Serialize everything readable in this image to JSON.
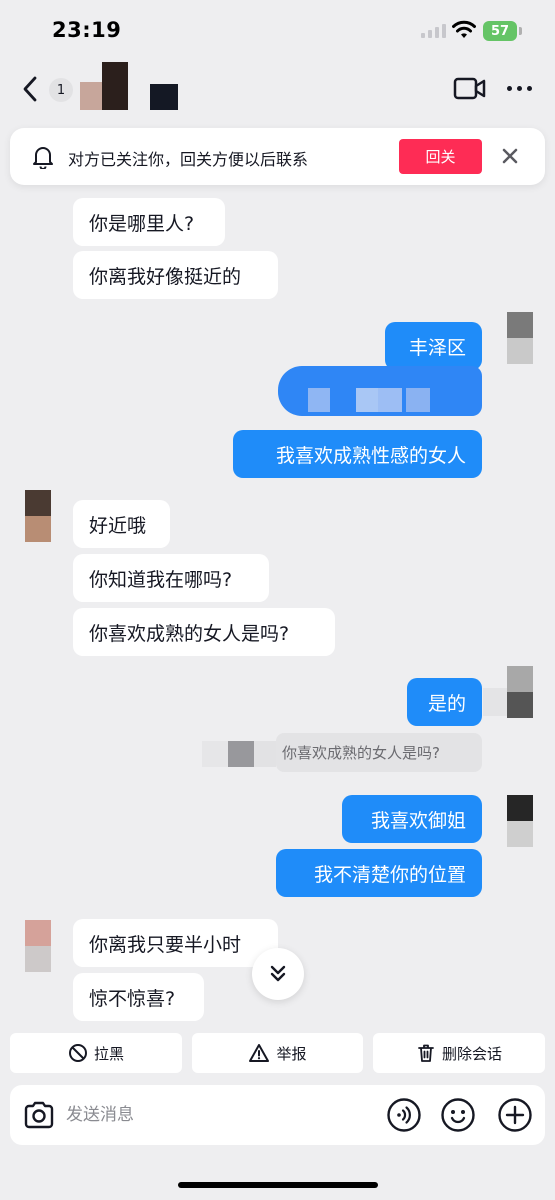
{
  "status_bar": {
    "time": "23:19",
    "battery": "57"
  },
  "nav": {
    "unread_count": "1"
  },
  "follow_banner": {
    "text": "对方已关注你，回关方便以后联系",
    "button": "回关"
  },
  "messages": [
    {
      "from": "them",
      "text": "你是哪里人?"
    },
    {
      "from": "them",
      "text": "你离我好像挺近的"
    },
    {
      "from": "me",
      "text": "丰泽区"
    },
    {
      "from": "me",
      "text": "我喜欢成熟性感的女人"
    },
    {
      "from": "them",
      "text": "好近哦"
    },
    {
      "from": "them",
      "text": "你知道我在哪吗?"
    },
    {
      "from": "them",
      "text": "你喜欢成熟的女人是吗?"
    },
    {
      "from": "me",
      "text": "是的"
    },
    {
      "from": "me",
      "text": "我喜欢御姐"
    },
    {
      "from": "me",
      "text": "我不清楚你的位置"
    },
    {
      "from": "them",
      "text": "你离我只要半小时"
    },
    {
      "from": "them",
      "text": "惊不惊喜?"
    }
  ],
  "quote": {
    "text": "你喜欢成熟的女人是吗?"
  },
  "actions": {
    "block": "拉黑",
    "report": "举报",
    "delete_chat": "删除会话"
  },
  "input": {
    "placeholder": "发送消息"
  },
  "colors": {
    "accent": "#fe2c55",
    "bubble_out": "#1f8cf9",
    "bubble_in": "#ffffff",
    "background": "#eeeef0"
  },
  "icons": [
    "back-icon",
    "video-call-icon",
    "more-icon",
    "bell-icon",
    "close-icon",
    "scroll-down-icon",
    "block-icon",
    "report-icon",
    "trash-icon",
    "camera-icon",
    "voice-icon",
    "emoji-icon",
    "plus-icon"
  ]
}
